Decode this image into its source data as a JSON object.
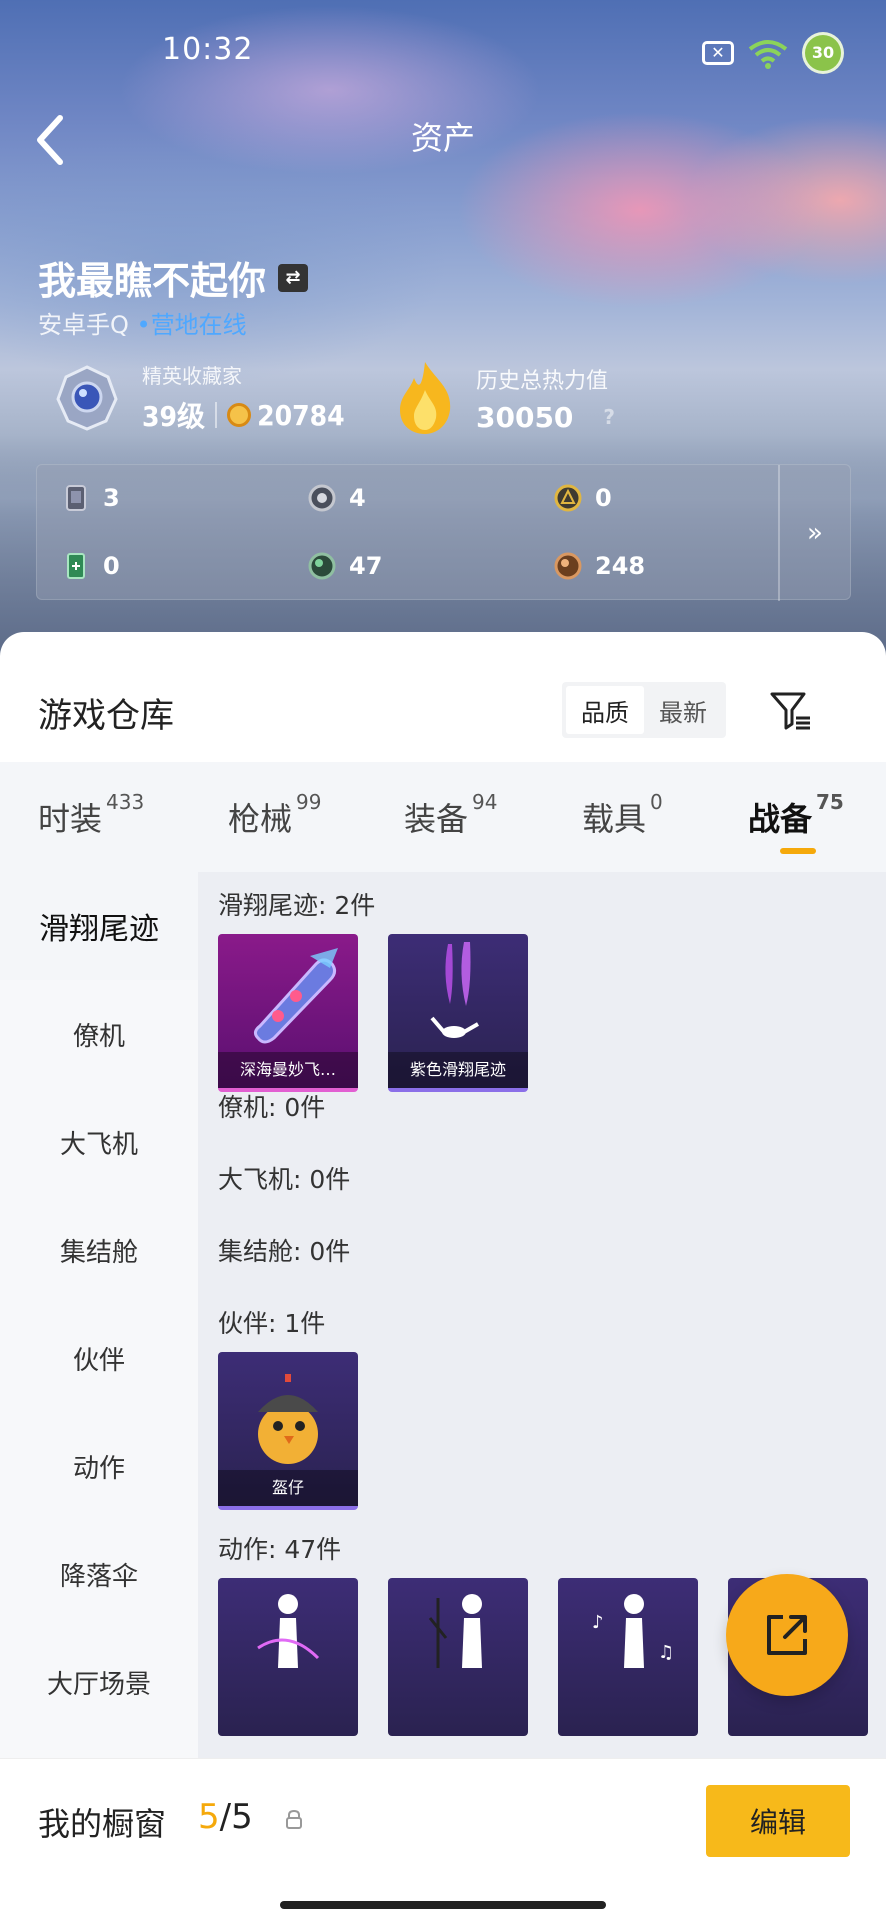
{
  "status_bar": {
    "time": "10:32",
    "battery": "30"
  },
  "header": {
    "title": "资产"
  },
  "profile": {
    "name": "我最瞧不起你",
    "platform": "安卓手Q",
    "online_dot": "•",
    "online_status": "营地在线",
    "rank_title": "精英收藏家",
    "level": "39级",
    "coins": "20784",
    "heat_title": "历史总热力值",
    "heat_value": "30050",
    "heat_help": "?"
  },
  "stats": [
    {
      "icon": "card-icon",
      "value": "3"
    },
    {
      "icon": "silver-token-icon",
      "value": "4"
    },
    {
      "icon": "gold-token-icon",
      "value": "0"
    },
    {
      "icon": "green-ticket-icon",
      "value": "0"
    },
    {
      "icon": "green-orb-icon",
      "value": "47"
    },
    {
      "icon": "bronze-orb-icon",
      "value": "248"
    }
  ],
  "stats_more": "»",
  "warehouse": {
    "title": "游戏仓库",
    "sort_options": [
      "品质",
      "最新"
    ],
    "active_sort": "品质"
  },
  "tabs": [
    {
      "label": "时装",
      "count": "433"
    },
    {
      "label": "枪械",
      "count": "99"
    },
    {
      "label": "装备",
      "count": "94"
    },
    {
      "label": "载具",
      "count": "0"
    },
    {
      "label": "战备",
      "count": "75"
    }
  ],
  "sidebar": [
    "滑翔尾迹",
    "僚机",
    "大飞机",
    "集结舱",
    "伙伴",
    "动作",
    "降落伞",
    "大厅场景"
  ],
  "groups": {
    "glide": {
      "label": "滑翔尾迹: 2件",
      "items": [
        "深海曼妙飞…",
        "紫色滑翔尾迹"
      ]
    },
    "wingman": {
      "label": "僚机: 0件"
    },
    "plane": {
      "label": "大飞机: 0件"
    },
    "capsule": {
      "label": "集结舱: 0件"
    },
    "partner": {
      "label": "伙伴: 1件",
      "items": [
        "盔仔"
      ]
    },
    "emote": {
      "label": "动作: 47件"
    }
  },
  "showcase": {
    "label": "我的橱窗",
    "current": "5",
    "sep": "/",
    "total": "5",
    "edit": "编辑"
  },
  "colors": {
    "accent": "#f5a90b",
    "online": "#4fa8ff",
    "card_pink": "#e25fd2",
    "card_purple": "#8b6fe8"
  }
}
